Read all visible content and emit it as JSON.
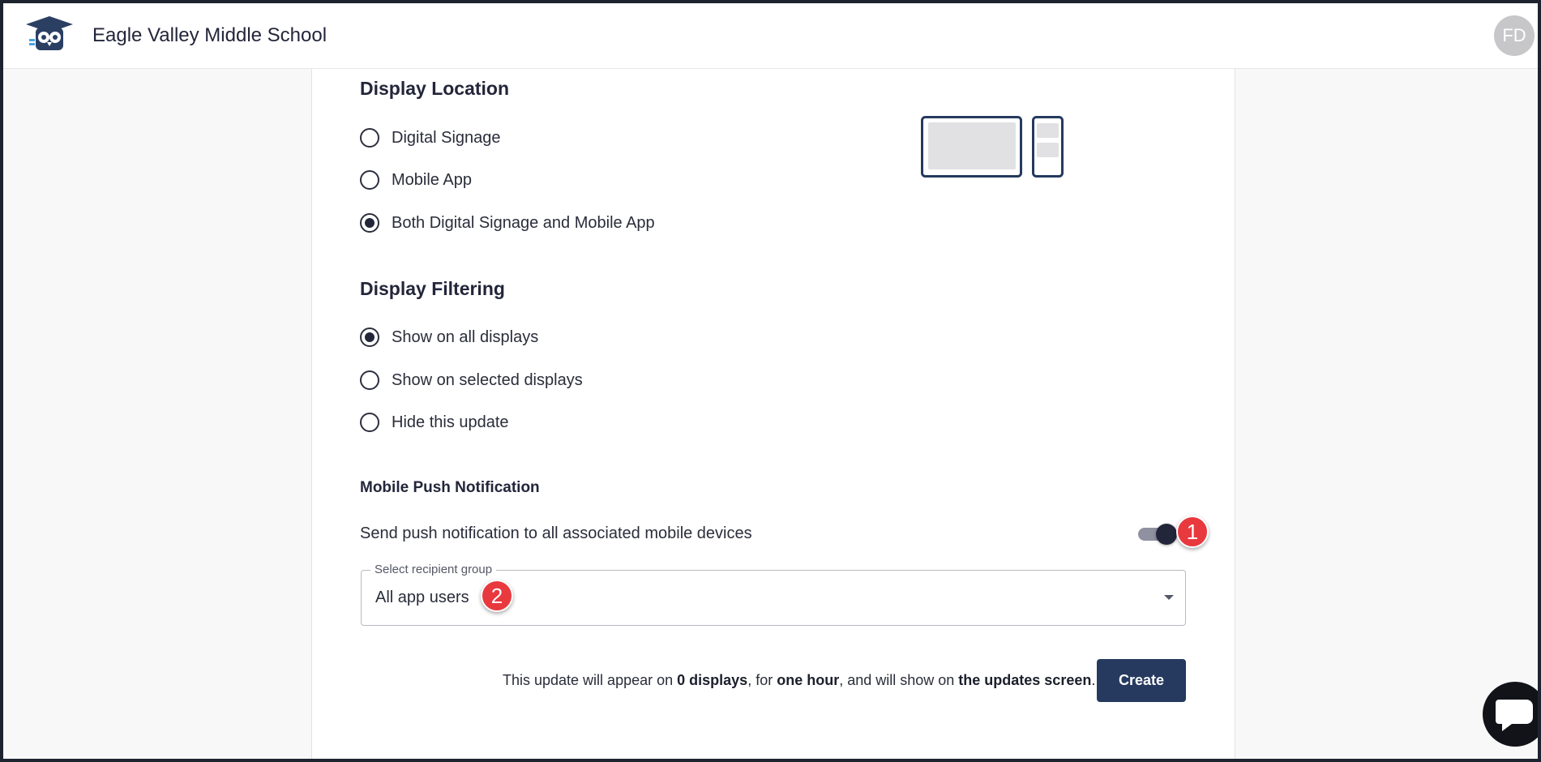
{
  "header": {
    "school_name": "Eagle Valley Middle School",
    "avatar_initials": "FD"
  },
  "display_location": {
    "title": "Display Location",
    "options": [
      {
        "label": "Digital Signage",
        "checked": false
      },
      {
        "label": "Mobile App",
        "checked": false
      },
      {
        "label": "Both Digital Signage and Mobile App",
        "checked": true
      }
    ]
  },
  "display_filtering": {
    "title": "Display Filtering",
    "options": [
      {
        "label": "Show on all displays",
        "checked": true
      },
      {
        "label": "Show on selected displays",
        "checked": false
      },
      {
        "label": "Hide this update",
        "checked": false
      }
    ]
  },
  "push": {
    "title": "Mobile Push Notification",
    "toggle_label": "Send push notification to all associated mobile devices",
    "toggle_on": true,
    "select_label": "Select recipient group",
    "select_value": "All app users"
  },
  "annotations": [
    "1",
    "2"
  ],
  "summary": {
    "prefix": "This update will appear on ",
    "displays": "0 displays",
    "mid1": ", for ",
    "duration": "one hour",
    "mid2": ", and will show on ",
    "screen": "the updates screen",
    "suffix": "."
  },
  "actions": {
    "create_label": "Create"
  },
  "colors": {
    "primary": "#253a5e",
    "badge": "#e8393f",
    "text": "#2a2d3a"
  },
  "icons": {
    "logo": "owl-graduation-cap-icon",
    "chat": "chat-bubble-icon"
  }
}
